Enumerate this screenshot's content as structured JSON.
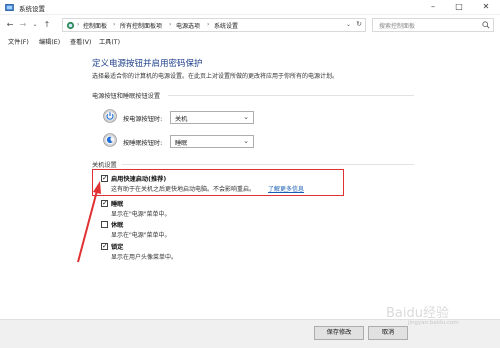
{
  "window": {
    "title": "系统设置"
  },
  "addressbar": {
    "breadcrumbs": [
      "控制面板",
      "所有控制面板项",
      "电源选项",
      "系统设置"
    ],
    "search_placeholder": "搜索控制面板"
  },
  "menu": [
    "文件(F)",
    "编辑(E)",
    "查看(V)",
    "工具(T)"
  ],
  "page": {
    "title": "定义电源按钮并启用密码保护",
    "description": "选择最适合你的计算机的电源设置。在此页上对设置所做的更改将应用于你所有的电源计划。"
  },
  "power_section": {
    "title": "电源按钮和睡眠按钮设置",
    "rows": [
      {
        "label": "按电源按钮时:",
        "value": "关机"
      },
      {
        "label": "按睡眠按钮时:",
        "value": "睡眠"
      }
    ]
  },
  "shutdown_section": {
    "title": "关机设置",
    "items": [
      {
        "label": "启用快速启动(推荐)",
        "checked": true,
        "desc": "这有助于在关机之后更快地启动电脑。不会影响重启。",
        "link": "了解更多信息"
      },
      {
        "label": "睡眠",
        "checked": true,
        "desc": "显示在\"电源\"菜单中。"
      },
      {
        "label": "休眠",
        "checked": false,
        "desc": "显示在\"电源\"菜单中。"
      },
      {
        "label": "锁定",
        "checked": true,
        "desc": "显示在用户头像菜单中。"
      }
    ]
  },
  "footer": {
    "save": "保存修改",
    "cancel": "取消"
  },
  "watermark": {
    "brand": "Baidu经验",
    "url": "jingyan.baidu.com"
  },
  "colors": {
    "heading": "#1e3f8a",
    "link": "#1a5fb4",
    "highlight": "#e03232"
  }
}
